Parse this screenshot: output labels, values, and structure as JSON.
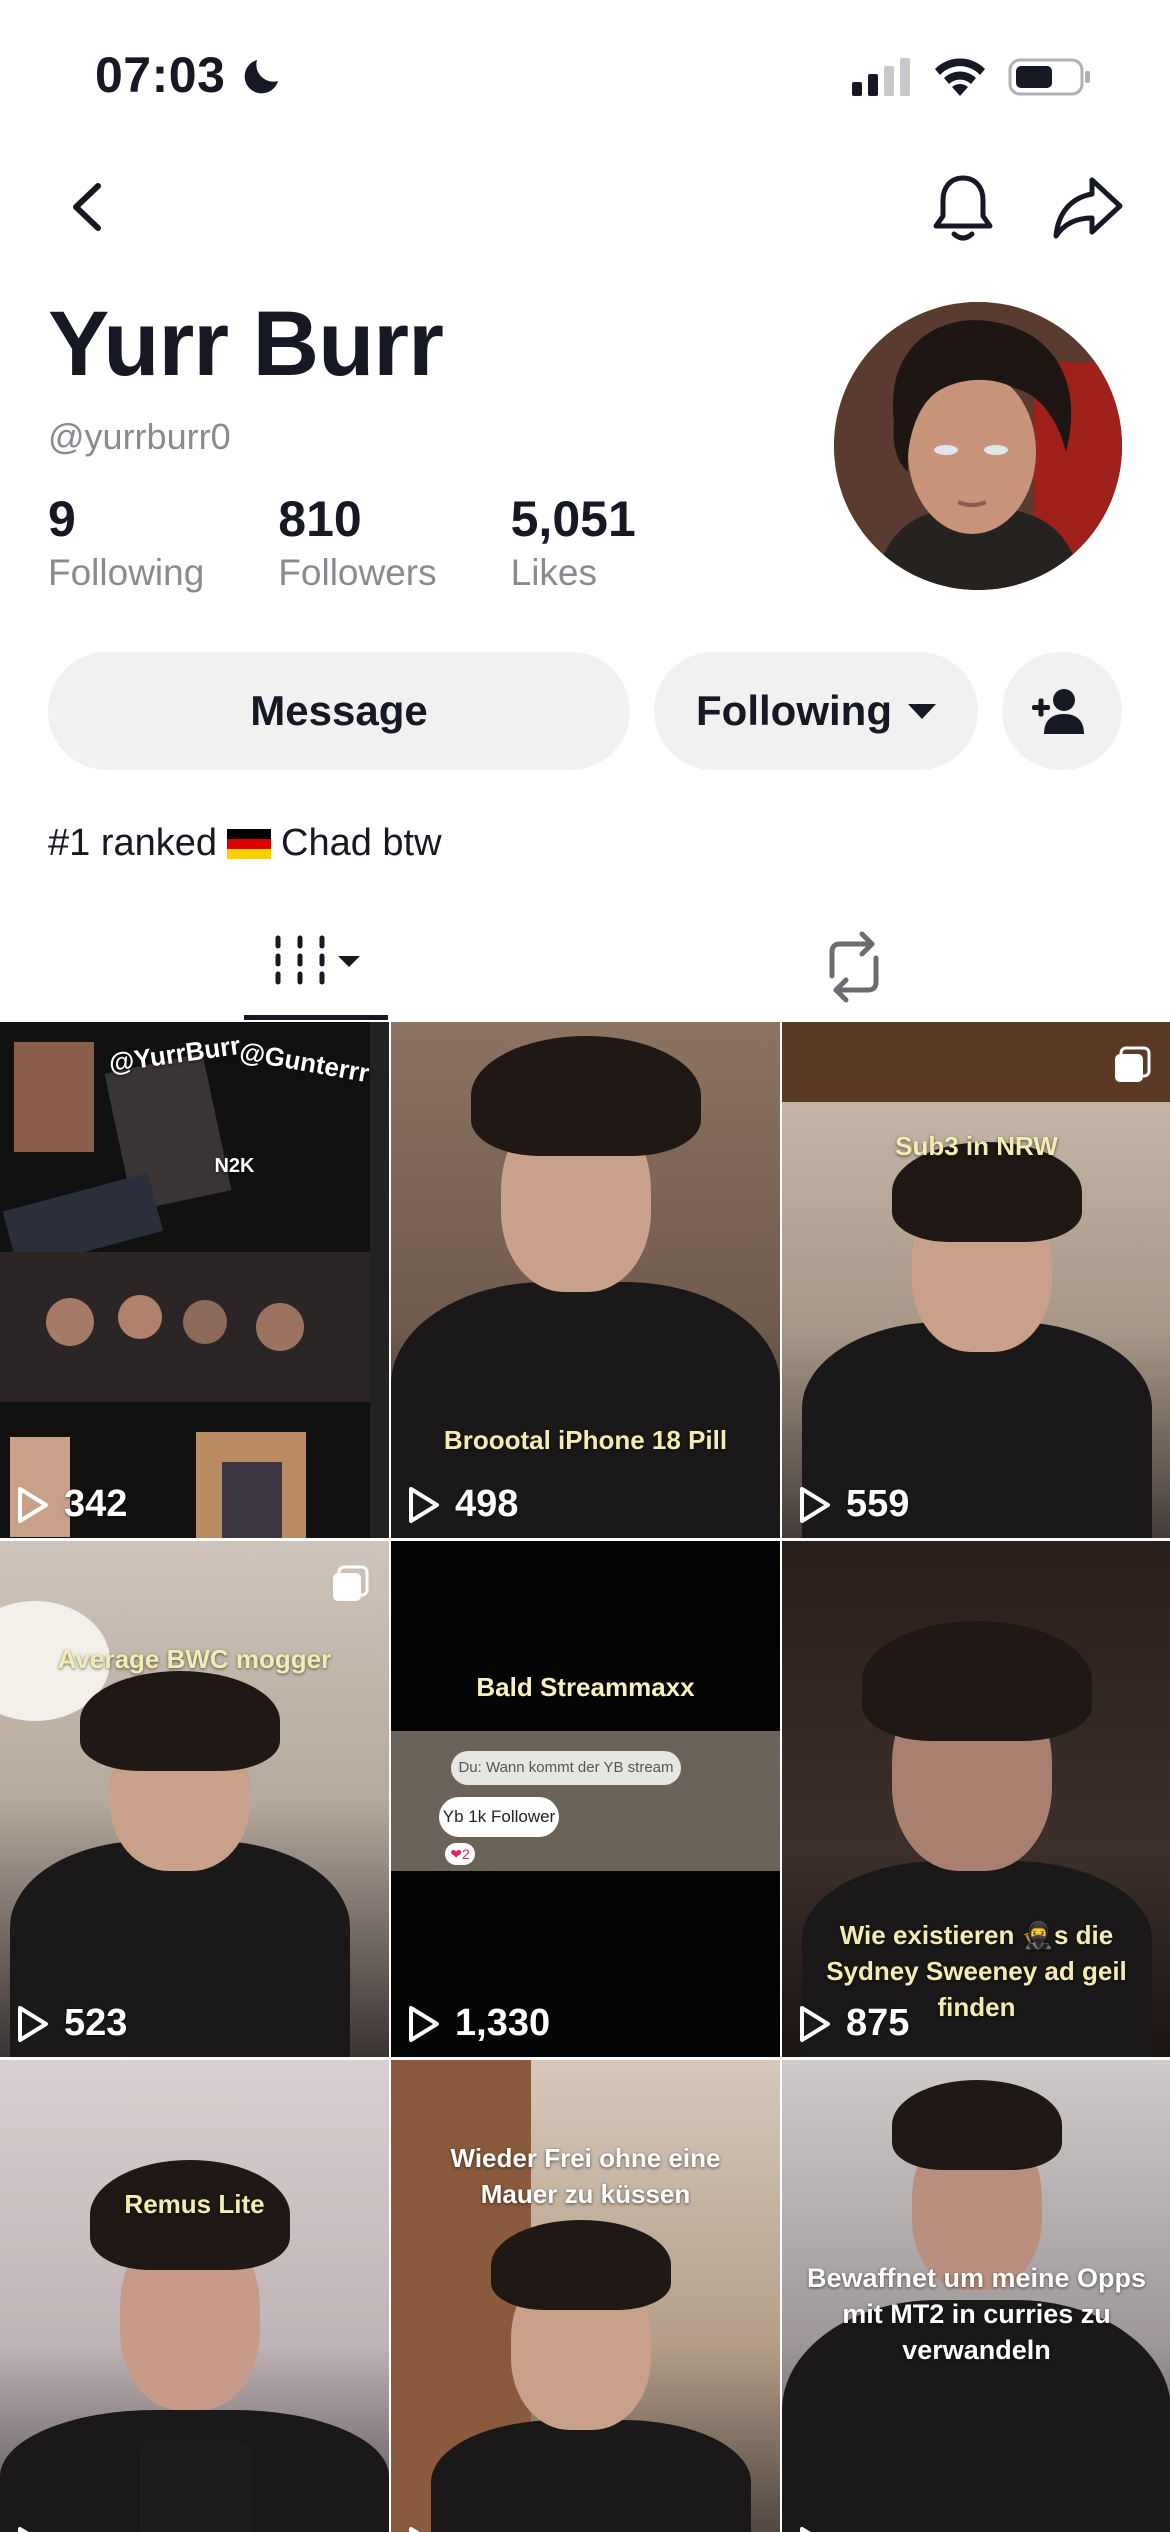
{
  "status_bar": {
    "time": "07:03"
  },
  "profile": {
    "display_name": "Yurr Burr",
    "username": "@yurrburr0",
    "stats": [
      {
        "value": "9",
        "label": "Following"
      },
      {
        "value": "810",
        "label": "Followers"
      },
      {
        "value": "5,051",
        "label": "Likes"
      }
    ],
    "bio_before_flag": "#1 ranked",
    "bio_after_flag": "Chad btw"
  },
  "actions": {
    "message_label": "Message",
    "following_label": "Following"
  },
  "icons": {
    "back": "chevron-left-icon",
    "bell": "bell-icon",
    "share": "share-icon",
    "add_user": "person-plus-icon",
    "grid_tab": "video-grid-icon",
    "repost_tab": "repost-icon",
    "play": "play-icon",
    "multi": "photo-carousel-icon"
  },
  "colors": {
    "text": "#161823",
    "secondary_text": "#8a8b91",
    "button_bg": "#f1f1f2",
    "caption_yellow": "#f4ecb0"
  },
  "videos": [
    {
      "views": "342",
      "caption": "",
      "overlay_texts": [
        "@YurrBurr",
        "@Gunterrr",
        "N2K"
      ]
    },
    {
      "views": "498",
      "caption": "Broootal iPhone 18 Pill"
    },
    {
      "views": "559",
      "caption": "Sub3 in NRW"
    },
    {
      "views": "523",
      "caption": "Average BWC mogger"
    },
    {
      "views": "1,330",
      "caption": "Bald Streammaxx",
      "overlay_texts": [
        "Du: Wann kommt der YB stream",
        "Yb 1k Follower",
        "2"
      ]
    },
    {
      "views": "875",
      "caption": "Wie existieren 🥷s die Sydney Sweeney ad geil finden"
    },
    {
      "views": "",
      "caption": "Remus Lite"
    },
    {
      "views": "",
      "caption": "Wieder Frei ohne eine Mauer zu küssen"
    },
    {
      "views": "",
      "caption": "Bewaffnet um meine Opps mit MT2 in curries zu verwandeln"
    }
  ]
}
